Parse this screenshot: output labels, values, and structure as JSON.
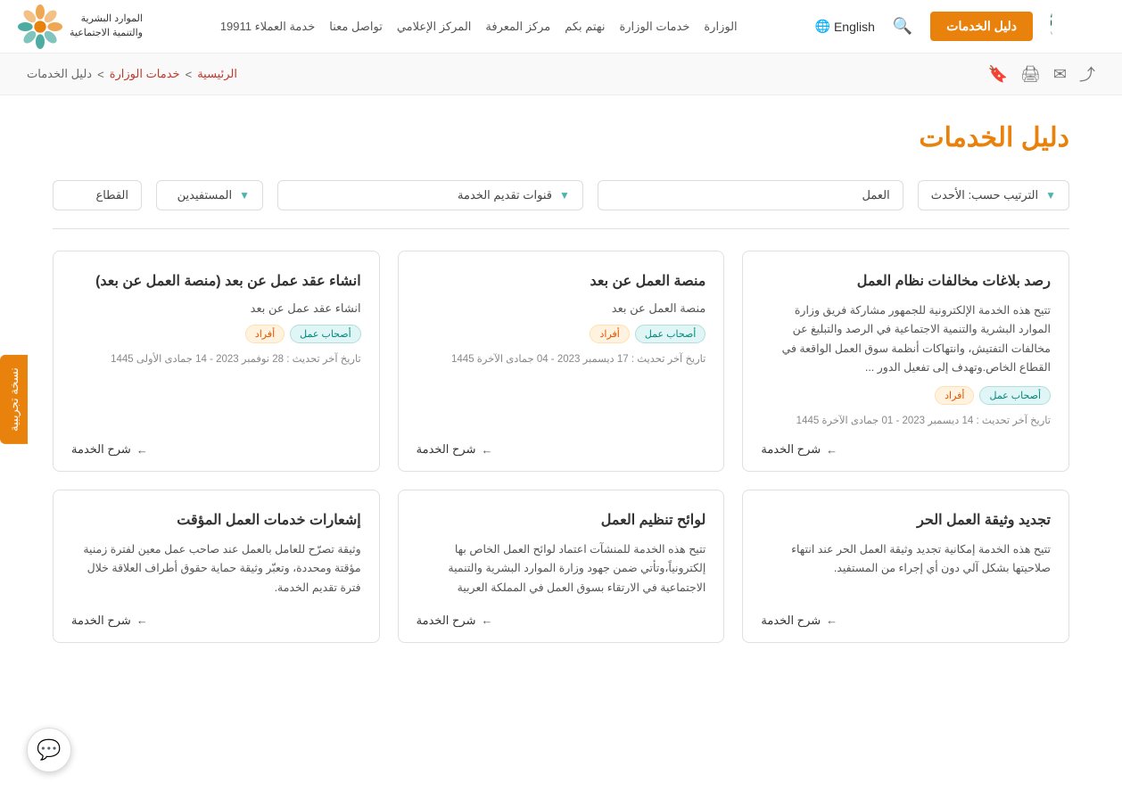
{
  "header": {
    "guide_btn": "دليل الخدمات",
    "lang": "English",
    "nav": [
      {
        "label": "الوزارة"
      },
      {
        "label": "خدمات الوزارة"
      },
      {
        "label": "نهتم بكم"
      },
      {
        "label": "مركز المعرفة"
      },
      {
        "label": "المركز الإعلامي"
      },
      {
        "label": "تواصل معنا"
      },
      {
        "label": "خدمة العملاء 19911"
      }
    ],
    "ministry_name_line1": "الموارد البشرية",
    "ministry_name_line2": "والتنمية الاجتماعية"
  },
  "breadcrumb": {
    "home": "الرئيسية",
    "sep1": ">",
    "level2": "خدمات الوزارة",
    "sep2": ">",
    "level3": "دليل الخدمات"
  },
  "side_tab": "نسخة تجريبية",
  "page": {
    "title": "دليل الخدمات",
    "filters": {
      "sector_label": "القطاع",
      "beneficiary_label": "المستفيدين",
      "channel_label": "قنوات تقديم الخدمة",
      "work_label": "العمل",
      "sort_label": "الترتيب حسب: الأحدث"
    }
  },
  "cards": [
    {
      "title": "رصد بلاغات مخالفات نظام العمل",
      "desc": "تتيح هذه الخدمة الإلكترونية للجمهور مشاركة فريق وزارة الموارد البشرية والتنمية الاجتماعية في الرصد والتبليغ عن مخالفات التفتيش، وانتهاكات أنظمة سوق العمل الواقعة في القطاع الخاص.وتهدف إلى تفعيل الدور ...",
      "tags": [
        "أصحاب عمل",
        "أفراد"
      ],
      "date": "تاريخ آخر تحديث : 14 ديسمبر 2023 - 01 جمادى الآخرة 1445",
      "link": "شرح الخدمة"
    },
    {
      "title": "منصة العمل عن بعد",
      "subtitle": "منصة العمل عن بعد",
      "tags": [
        "أصحاب عمل",
        "أفراد"
      ],
      "date": "تاريخ آخر تحديث : 17 ديسمبر 2023 - 04 جمادى الآخرة 1445",
      "link": "شرح الخدمة"
    },
    {
      "title": "انشاء عقد عمل عن بعد (منصة العمل عن بعد)",
      "subtitle": "انشاء عقد عمل عن بعد",
      "tags": [
        "أصحاب عمل",
        "أفراد"
      ],
      "date": "تاريخ آخر تحديث : 28 نوفمبر 2023 - 14 جمادى الأولى 1445",
      "link": "شرح الخدمة"
    },
    {
      "title": "تجديد وثيقة العمل الحر",
      "desc": "تتيح هذه الخدمة إمكانية تجديد وثيقة العمل الحر عند انتهاء صلاحيتها بشكل آلي دون أي إجراء من المستفيد.",
      "tags": [],
      "date": "",
      "link": "شرح الخدمة"
    },
    {
      "title": "لوائح تنظيم العمل",
      "desc": "تتيح هذه الخدمة للمنشآت اعتماد لوائح العمل الخاص بها إلكترونياً،وتأتي ضمن جهود وزارة الموارد البشرية والتنمية الاجتماعية في الارتقاء بسوق العمل في المملكة العربية",
      "tags": [],
      "date": "",
      "link": "شرح الخدمة"
    },
    {
      "title": "إشعارات خدمات العمل المؤقت",
      "desc": "وثيقة تصرّح للعامل بالعمل عند صاحب عمل معين لفترة زمنية مؤقتة ومحددة، وتعبّر وثيقة حماية حقوق أطراف العلاقة خلال فترة تقديم الخدمة.",
      "tags": [],
      "date": "",
      "link": "شرح الخدمة"
    }
  ]
}
